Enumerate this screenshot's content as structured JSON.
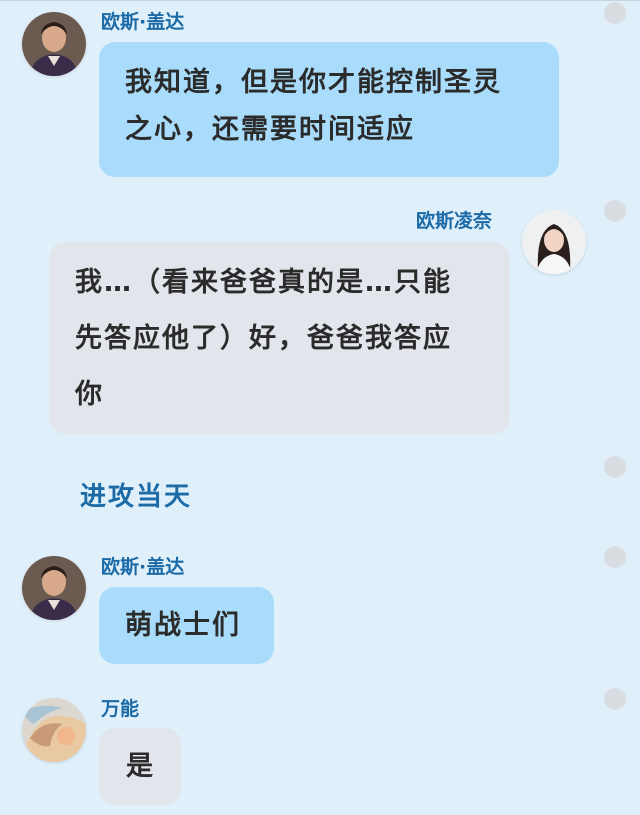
{
  "messages": [
    {
      "sender": "欧斯·盖达",
      "lines": [
        "我知道，但是你才能控制圣灵",
        "之心，还需要时间适应"
      ]
    },
    {
      "sender": "欧斯凌奈",
      "lines": [
        "我…（看来爸爸真的是…只能",
        "先答应他了）好，爸爸我答应",
        "你"
      ]
    },
    {
      "sender": "欧斯·盖达",
      "lines": [
        "萌战士们"
      ]
    },
    {
      "sender": "万能",
      "lines": [
        "是"
      ]
    }
  ],
  "section_title": "进攻当天",
  "colors": {
    "background": "#dff0fb",
    "name_text": "#1c6aa6",
    "blue_bubble": "#a9dcfa",
    "gray_bubble": "#e2e6ec"
  }
}
